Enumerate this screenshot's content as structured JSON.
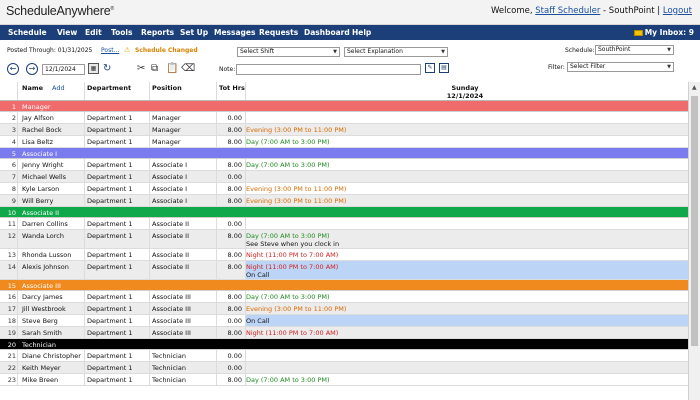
{
  "app": {
    "logo_a": "Schedule",
    "logo_b": "Anywhere",
    "welcome": "Welcome,",
    "user": "Staff Scheduler",
    "location": "- SouthPoint |",
    "logout": "Logout"
  },
  "nav": {
    "items": [
      "Schedule",
      "View",
      "Edit",
      "Tools",
      "Reports",
      "Set Up",
      "Messages",
      "Requests",
      "Dashboard",
      "Help"
    ],
    "inbox": "My Inbox: 9"
  },
  "toolbar": {
    "posted_through": "Posted Through: 01/31/2025",
    "post_link": "Post...",
    "schedule_changed": "Schedule Changed",
    "select_shift": "Select Shift",
    "select_explanation": "Select Explanation",
    "schedule_label": "Schedule:",
    "schedule_value": "SouthPoint",
    "date_value": "12/1/2024",
    "note_label": "Note:",
    "filter_label": "Filter:",
    "filter_value": "Select Filter"
  },
  "grid": {
    "headers": {
      "name": "Name",
      "add": "Add",
      "department": "Department",
      "position": "Position",
      "tot_hrs": "Tot Hrs",
      "day_name": "Sunday",
      "day_date": "12/1/2024"
    },
    "rows": [
      {
        "kind": "group",
        "num": "1",
        "label": "Manager",
        "color": "#f06b6b"
      },
      {
        "kind": "emp",
        "num": "2",
        "name": "Jay Alfson",
        "dept": "Department 1",
        "pos": "Manager",
        "hrs": "0.00",
        "shift": "",
        "shift_color": "",
        "note": "",
        "bg": ""
      },
      {
        "kind": "emp",
        "num": "3",
        "name": "Rachel Bock",
        "dept": "Department 1",
        "pos": "Manager",
        "hrs": "8.00",
        "shift": "Evening (3:00 PM to 11:00 PM)",
        "shift_color": "#d66a00",
        "note": "",
        "bg": ""
      },
      {
        "kind": "emp",
        "num": "4",
        "name": "Lisa Beltz",
        "dept": "Department 1",
        "pos": "Manager",
        "hrs": "8.00",
        "shift": "Day (7:00 AM to 3:00 PM)",
        "shift_color": "#1f8a1f",
        "note": "",
        "bg": ""
      },
      {
        "kind": "group",
        "num": "5",
        "label": "Associate I",
        "color": "#7b7bf0"
      },
      {
        "kind": "emp",
        "num": "6",
        "name": "Jenny Wright",
        "dept": "Department 1",
        "pos": "Associate I",
        "hrs": "8.00",
        "shift": "Day (7:00 AM to 3:00 PM)",
        "shift_color": "#1f8a1f",
        "note": "",
        "bg": ""
      },
      {
        "kind": "emp",
        "num": "7",
        "name": "Michael Wells",
        "dept": "Department 1",
        "pos": "Associate I",
        "hrs": "0.00",
        "shift": "",
        "shift_color": "",
        "note": "",
        "bg": ""
      },
      {
        "kind": "emp",
        "num": "8",
        "name": "Kyle Larson",
        "dept": "Department 1",
        "pos": "Associate I",
        "hrs": "8.00",
        "shift": "Evening (3:00 PM to 11:00 PM)",
        "shift_color": "#d66a00",
        "note": "",
        "bg": ""
      },
      {
        "kind": "emp",
        "num": "9",
        "name": "Will Berry",
        "dept": "Department 1",
        "pos": "Associate I",
        "hrs": "8.00",
        "shift": "Evening (3:00 PM to 11:00 PM)",
        "shift_color": "#d66a00",
        "note": "",
        "bg": ""
      },
      {
        "kind": "group",
        "num": "10",
        "label": "Associate II",
        "color": "#10a84a"
      },
      {
        "kind": "emp",
        "num": "11",
        "name": "Darren Collins",
        "dept": "Department 1",
        "pos": "Associate II",
        "hrs": "0.00",
        "shift": "",
        "shift_color": "",
        "note": "",
        "bg": ""
      },
      {
        "kind": "emp",
        "num": "12",
        "name": "Wanda Lorch",
        "dept": "Department 1",
        "pos": "Associate II",
        "hrs": "8.00",
        "shift": "Day (7:00 AM to 3:00 PM)",
        "shift_color": "#1f8a1f",
        "note": "See Steve when you clock in",
        "bg": ""
      },
      {
        "kind": "emp",
        "num": "13",
        "name": "Rhonda Lusson",
        "dept": "Department 1",
        "pos": "Associate II",
        "hrs": "8.00",
        "shift": "Night (11:00 PM to 7:00 AM)",
        "shift_color": "#d01f1f",
        "note": "",
        "bg": ""
      },
      {
        "kind": "emp",
        "num": "14",
        "name": "Alexis Johnson",
        "dept": "Department 1",
        "pos": "Associate II",
        "hrs": "8.00",
        "shift": "Night (11:00 PM to 7:00 AM)",
        "shift_color": "#d01f1f",
        "note": "On Call",
        "bg": "#bcd4f5"
      },
      {
        "kind": "group",
        "num": "15",
        "label": "Associate III",
        "color": "#f08a1e"
      },
      {
        "kind": "emp",
        "num": "16",
        "name": "Darcy James",
        "dept": "Department 1",
        "pos": "Associate III",
        "hrs": "8.00",
        "shift": "Day (7:00 AM to 3:00 PM)",
        "shift_color": "#1f8a1f",
        "note": "",
        "bg": ""
      },
      {
        "kind": "emp",
        "num": "17",
        "name": "Jill Westbrook",
        "dept": "Department 1",
        "pos": "Associate III",
        "hrs": "8.00",
        "shift": "Evening (3:00 PM to 11:00 PM)",
        "shift_color": "#d66a00",
        "note": "",
        "bg": ""
      },
      {
        "kind": "emp",
        "num": "18",
        "name": "Steve Berg",
        "dept": "Department 1",
        "pos": "Associate III",
        "hrs": "0.00",
        "shift": "On Call",
        "shift_color": "#111111",
        "note": "",
        "bg": "#bcd4f5"
      },
      {
        "kind": "emp",
        "num": "19",
        "name": "Sarah Smith",
        "dept": "Department 1",
        "pos": "Associate III",
        "hrs": "8.00",
        "shift": "Night (11:00 PM to 7:00 AM)",
        "shift_color": "#d01f1f",
        "note": "",
        "bg": ""
      },
      {
        "kind": "group",
        "num": "20",
        "label": "Technician",
        "color": "#000000"
      },
      {
        "kind": "emp",
        "num": "21",
        "name": "Diane Christopher",
        "dept": "Department 1",
        "pos": "Technician",
        "hrs": "0.00",
        "shift": "",
        "shift_color": "",
        "note": "",
        "bg": ""
      },
      {
        "kind": "emp",
        "num": "22",
        "name": "Keith Meyer",
        "dept": "Department 1",
        "pos": "Technician",
        "hrs": "0.00",
        "shift": "",
        "shift_color": "",
        "note": "",
        "bg": ""
      },
      {
        "kind": "emp",
        "num": "23",
        "name": "Mike Breen",
        "dept": "Department 1",
        "pos": "Technician",
        "hrs": "8.00",
        "shift": "Day (7:00 AM to 3:00 PM)",
        "shift_color": "#1f8a1f",
        "note": "",
        "bg": ""
      }
    ]
  }
}
